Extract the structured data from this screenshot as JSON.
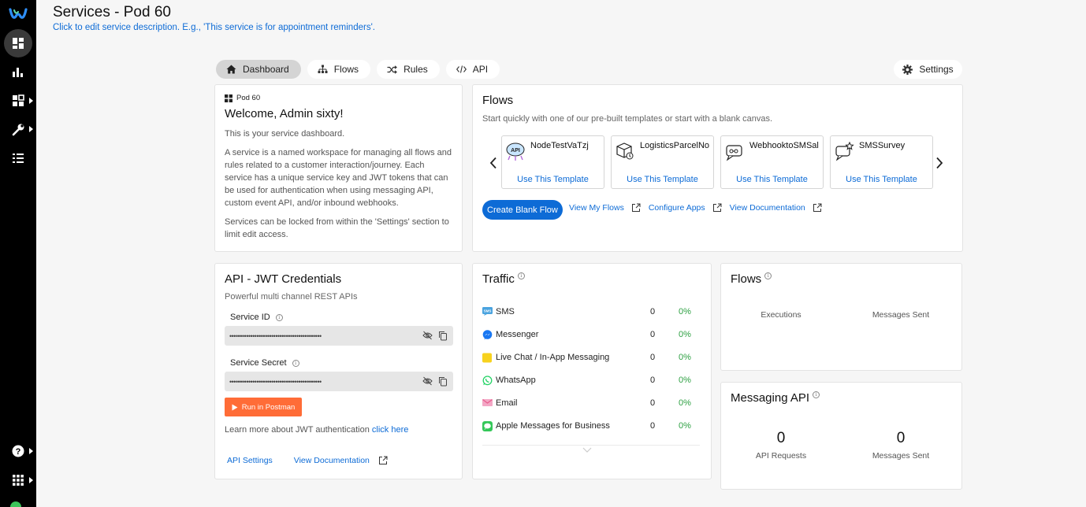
{
  "header": {
    "title": "Services - Pod 60",
    "description": "Click to edit service description. E.g., 'This service is for appointment reminders'."
  },
  "tabs": [
    {
      "label": "Dashboard",
      "icon": "home-icon",
      "active": true
    },
    {
      "label": "Flows",
      "icon": "sitemap-icon",
      "active": false
    },
    {
      "label": "Rules",
      "icon": "shuffle-icon",
      "active": false
    },
    {
      "label": "API",
      "icon": "code-icon",
      "active": false
    }
  ],
  "settings_label": "Settings",
  "welcome": {
    "pod_name": "Pod 60",
    "title": "Welcome, Admin sixty!",
    "p1": "This is your service dashboard.",
    "p2": "A service is a named workspace for managing all flows and rules related to a customer interaction/journey. Each service has a unique service key and JWT tokens that can be used for authentication when using messaging API, custom event API, and/or inbound webhooks.",
    "p3": "Services can be locked from within the 'Settings' section to limit edit access."
  },
  "flows_panel": {
    "title": "Flows",
    "subtitle": "Start quickly with one of our pre-built templates or start with a blank canvas.",
    "templates": [
      {
        "name": "NodeTestVaTzj",
        "action": "Use This Template",
        "icon": "api-cloud-icon"
      },
      {
        "name": "LogisticsParcelNo",
        "action": "Use This Template",
        "icon": "parcel-icon"
      },
      {
        "name": "WebhooktoSMSal",
        "action": "Use This Template",
        "icon": "webhook-icon"
      },
      {
        "name": "SMSSurvey",
        "action": "Use This Template",
        "icon": "survey-icon"
      }
    ],
    "blank_button": "Create Blank Flow",
    "links": [
      "View My Flows",
      "Configure Apps",
      "View Documentation"
    ]
  },
  "api_card": {
    "title": "API - JWT Credentials",
    "subtitle": "Powerful multi channel REST APIs",
    "service_id_label": "Service ID",
    "service_id_value": "••••••••••••••••••••••••••••••••••••••••••••",
    "service_secret_label": "Service Secret",
    "service_secret_value": "••••••••••••••••••••••••••••••••••••••••••••",
    "postman_label": "Run in Postman",
    "learn_text": "Learn more about JWT authentication ",
    "learn_link": "click here",
    "settings_link": "API Settings",
    "docs_link": "View Documentation"
  },
  "traffic": {
    "title": "Traffic",
    "rows": [
      {
        "channel": "SMS",
        "count": "0",
        "percent": "0%",
        "icon": "sms-icon",
        "color": "#4aa3df"
      },
      {
        "channel": "Messenger",
        "count": "0",
        "percent": "0%",
        "icon": "messenger-icon",
        "color": "#1877f2"
      },
      {
        "channel": "Live Chat / In-App Messaging",
        "count": "0",
        "percent": "0%",
        "icon": "livechat-icon",
        "color": "#f7d21e"
      },
      {
        "channel": "WhatsApp",
        "count": "0",
        "percent": "0%",
        "icon": "whatsapp-icon",
        "color": "#25d366"
      },
      {
        "channel": "Email",
        "count": "0",
        "percent": "0%",
        "icon": "email-icon",
        "color": "#e85a8c"
      },
      {
        "channel": "Apple Messages for Business",
        "count": "0",
        "percent": "0%",
        "icon": "apple-messages-icon",
        "color": "#34c759"
      }
    ]
  },
  "flows_stats": {
    "title": "Flows",
    "executions_label": "Executions",
    "messages_label": "Messages Sent"
  },
  "messaging_api": {
    "title": "Messaging API",
    "api_requests_value": "0",
    "api_requests_label": "API Requests",
    "messages_value": "0",
    "messages_label": "Messages Sent"
  }
}
